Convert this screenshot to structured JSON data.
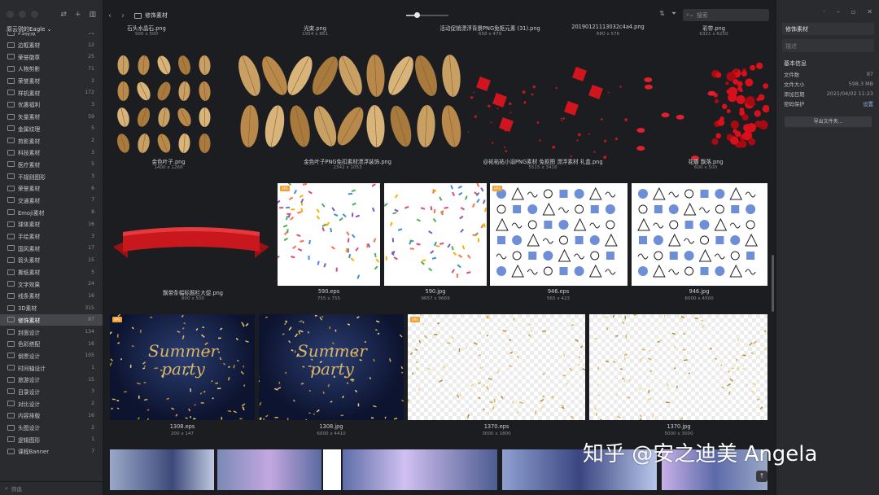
{
  "sidebar": {
    "library_title": "原云锐的Eagle ⌄",
    "filter_placeholder": "筛选",
    "folders": [
      {
        "name": "PS特效",
        "count": "51"
      },
      {
        "name": "边框素材",
        "count": "12"
      },
      {
        "name": "荣誉徽章",
        "count": "25"
      },
      {
        "name": "人物剪影",
        "count": "71"
      },
      {
        "name": "荣誉素材",
        "count": "2"
      },
      {
        "name": "样机素材",
        "count": "172"
      },
      {
        "name": "优惠福利",
        "count": "3"
      },
      {
        "name": "矢量素材",
        "count": "59"
      },
      {
        "name": "金属纹理",
        "count": "5"
      },
      {
        "name": "剪影素材",
        "count": "2"
      },
      {
        "name": "科技素材",
        "count": "3"
      },
      {
        "name": "医疗素材",
        "count": "5"
      },
      {
        "name": "不规则图形",
        "count": "3"
      },
      {
        "name": "荣誉素材",
        "count": "6"
      },
      {
        "name": "交通素材",
        "count": "7"
      },
      {
        "name": "Emoji素材",
        "count": "8"
      },
      {
        "name": "球体素材",
        "count": "16"
      },
      {
        "name": "手绘素材",
        "count": "3"
      },
      {
        "name": "国风素材",
        "count": "17"
      },
      {
        "name": "箭头素材",
        "count": "15"
      },
      {
        "name": "撕纸素材",
        "count": "5"
      },
      {
        "name": "文字效果",
        "count": "24"
      },
      {
        "name": "线条素材",
        "count": "16"
      },
      {
        "name": "3D素材",
        "count": "315"
      },
      {
        "name": "修饰素材",
        "count": "87"
      },
      {
        "name": "封面设计",
        "count": "134"
      },
      {
        "name": "色彩搭配",
        "count": "16"
      },
      {
        "name": "倒票设计",
        "count": "105"
      },
      {
        "name": "时间轴设计",
        "count": "1"
      },
      {
        "name": "旅游设计",
        "count": "15"
      },
      {
        "name": "目录设计",
        "count": "3"
      },
      {
        "name": "对比设计",
        "count": "2"
      },
      {
        "name": "内容排版",
        "count": "16"
      },
      {
        "name": "头图设计",
        "count": "2"
      },
      {
        "name": "逻辑图形",
        "count": "1"
      },
      {
        "name": "课程Banner",
        "count": "7"
      }
    ]
  },
  "toolbar": {
    "breadcrumb": "修饰素材",
    "search_placeholder": "搜索",
    "zoom": 0.25
  },
  "grid": {
    "row0": [
      {
        "name": "石头水晶石.png",
        "dims": "500 x 500"
      },
      {
        "name": "光束.png",
        "dims": "1954 x 861"
      },
      {
        "name": "活动促销漂浮背景PNG免抠元素 (31).png",
        "dims": "658 x 479"
      },
      {
        "name": "20190121113032c4a4.png",
        "dims": "680 x 576"
      },
      {
        "name": "彩带.png",
        "dims": "6321 x 6250"
      }
    ],
    "row1": [
      {
        "name": "金色叶子.png",
        "dims": "1400 x 1266"
      },
      {
        "name": "金色叶子PNG免扣素材漂浮装饰.png",
        "dims": "2342 x 1053"
      },
      {
        "name": "@祐祐祐小溺PNG素材 免抠图 漂浮素材 礼盒.png",
        "dims": "5515 x 3416"
      },
      {
        "name": "花瓣 飘落.png",
        "dims": "600 x 500"
      }
    ],
    "row2": [
      {
        "name": "飘带条幅标题栏大促.png",
        "dims": "800 x 500"
      },
      {
        "name": "590.eps",
        "dims": "755 x 755"
      },
      {
        "name": "590.jpg",
        "dims": "9657 x 9669"
      },
      {
        "name": "946.eps",
        "dims": "565 x 423"
      },
      {
        "name": "946.jpg",
        "dims": "6000 x 4500"
      }
    ],
    "row3": [
      {
        "name": "1308.eps",
        "dims": "200 x 147"
      },
      {
        "name": "1308.jpg",
        "dims": "6000 x 4410"
      },
      {
        "name": "1370.eps",
        "dims": "3000 x 1800"
      },
      {
        "name": "1370.jpg",
        "dims": "5000 x 3000"
      }
    ],
    "summer_text": "Summer party",
    "badge": "EPS"
  },
  "inspector": {
    "name": "修饰素材",
    "note_placeholder": "描述",
    "section": "基本信息",
    "rows": [
      {
        "k": "文件数",
        "v": "87"
      },
      {
        "k": "文件大小",
        "v": "598.3 MB"
      },
      {
        "k": "添加日期",
        "v": "2021/04/02 11:23"
      },
      {
        "k": "密码保护",
        "v": "设置"
      }
    ],
    "export_button": "导出文件夹..."
  },
  "watermark": "知乎 @安之迪美 Angela",
  "colors": {
    "accent": "#5b9cf0",
    "bg": "#1c1d20",
    "panel": "#2a2b2e",
    "gold": "#c9a064",
    "red": "#c8181e"
  }
}
